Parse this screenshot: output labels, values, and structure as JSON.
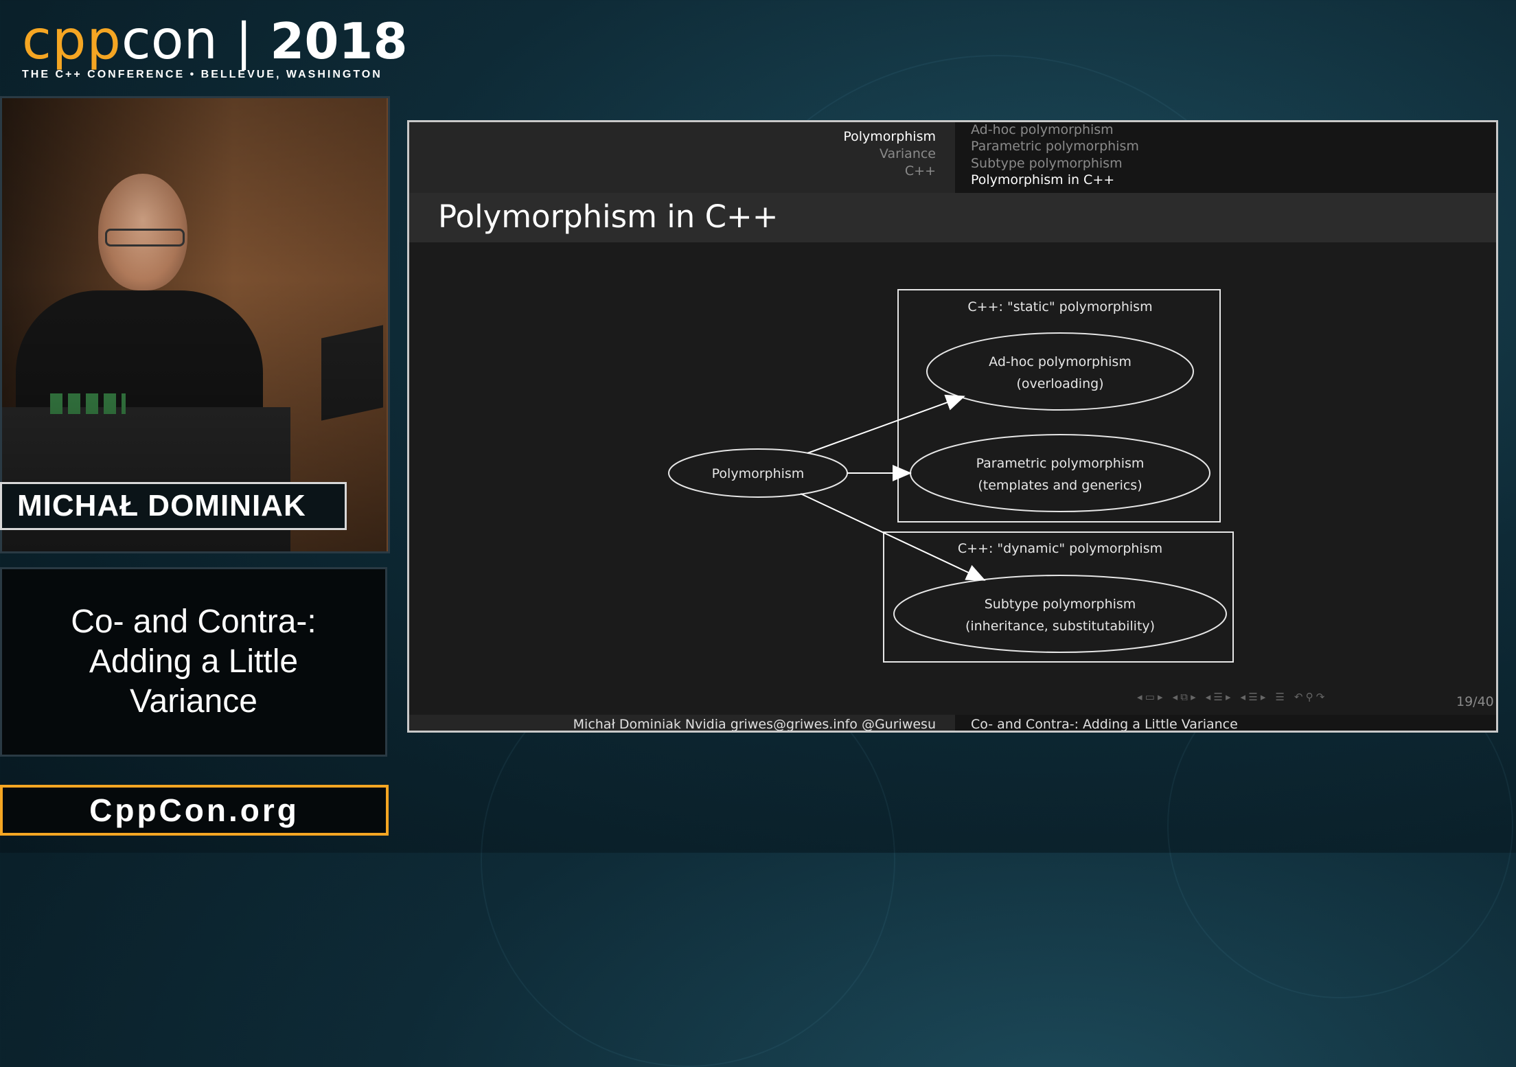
{
  "branding": {
    "logo_cpp": "cpp",
    "logo_con": "con",
    "logo_separator": "|",
    "logo_year": "2018",
    "tagline": "THE C++ CONFERENCE • BELLEVUE, WASHINGTON",
    "brand_color": "#f5a623"
  },
  "speaker": {
    "name": "MICHAŁ DOMINIAK"
  },
  "talk": {
    "title": "Co- and Contra-:\nAdding a Little\nVariance"
  },
  "site": {
    "url": "CppCon.org"
  },
  "slide": {
    "sections": [
      "Polymorphism",
      "Variance",
      "C++"
    ],
    "active_section": "Polymorphism",
    "subsections": [
      "Ad-hoc polymorphism",
      "Parametric polymorphism",
      "Subtype polymorphism",
      "Polymorphism in C++"
    ],
    "active_subsection": "Polymorphism in C++",
    "title": "Polymorphism in C++",
    "diagram": {
      "root": "Polymorphism",
      "clusters": [
        {
          "label": "C++: \"static\" polymorphism",
          "nodes": [
            {
              "line1": "Ad-hoc polymorphism",
              "line2": "(overloading)"
            },
            {
              "line1": "Parametric polymorphism",
              "line2": "(templates and generics)"
            }
          ]
        },
        {
          "label": "C++: \"dynamic\" polymorphism",
          "nodes": [
            {
              "line1": "Subtype polymorphism",
              "line2": "(inheritance, substitutability)"
            }
          ]
        }
      ]
    },
    "page": "19/40",
    "footer_author": "Michał Dominiak  Nvidia  griwes@griwes.info  @Guriwesu",
    "footer_title": "Co- and Contra-:   Adding a Little Variance"
  }
}
